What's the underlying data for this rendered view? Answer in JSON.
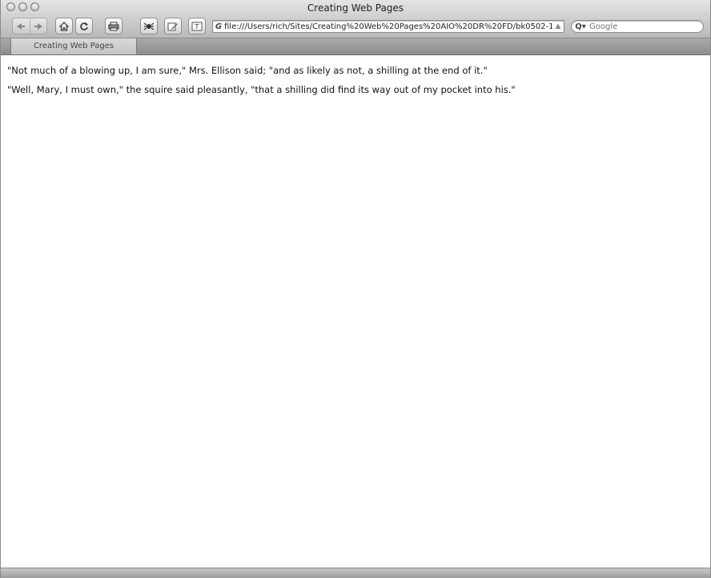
{
  "window": {
    "title": "Creating Web Pages"
  },
  "toolbar": {
    "back_icon": "back-arrow-icon",
    "forward_icon": "forward-arrow-icon",
    "home_icon": "home-icon",
    "reload_icon": "reload-icon",
    "print_icon": "print-icon",
    "bug_icon": "bug-icon",
    "edit_icon": "edit-icon",
    "textsize_icon": "text-size-icon"
  },
  "address": {
    "favicon": "G",
    "url": "file:///Users/rich/Sites/Creating%20Web%20Pages%20AIO%20DR%20FD/bk0502-1."
  },
  "search": {
    "prefix": "Q▾",
    "placeholder": "Google"
  },
  "tabs": [
    {
      "label": "Creating Web Pages"
    }
  ],
  "content": {
    "paragraphs": [
      "\"Not much of a blowing up, I am sure,\" Mrs. Ellison said; \"and as likely as not, a shilling at the end of it.\"",
      "\"Well, Mary, I must own,\" the squire said pleasantly, \"that a shilling did find its way out of my pocket into his.\""
    ]
  }
}
